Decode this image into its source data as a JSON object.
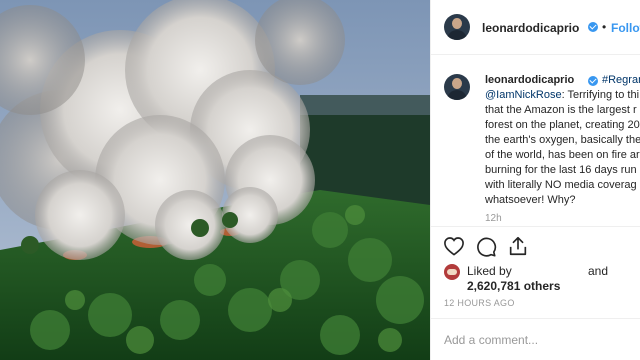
{
  "post": {
    "username": "leonardodicaprio",
    "follow_label": "Follow",
    "separator": "•",
    "caption": {
      "username": "leonardodicaprio",
      "line1": "#Regram #",
      "line2_mention": "@IamNickRose",
      "line2_rest": ": Terrifying to thi",
      "line3": "that the Amazon is the largest r",
      "line4": "forest on the planet, creating 20",
      "line5": "the earth's oxygen, basically the",
      "line6": "of the world, has been on fire ar",
      "line7": "burning for the last 16 days run",
      "line8": "with literally NO media coverag",
      "line9": "whatsoever! Why?"
    },
    "caption_time": "12h",
    "likes": {
      "liked_by_label": "Liked by",
      "and_label": "and",
      "count": "2,620,781 others"
    },
    "time_ago": "12 HOURS AGO",
    "comment_placeholder": "Add a comment..."
  },
  "colors": {
    "link": "#3897f0",
    "hashtag": "#003569",
    "text": "#262626",
    "muted": "#999999",
    "forest": "#1f5a23",
    "smoke": "#d8d6d3"
  },
  "icons": [
    "verified-badge-icon",
    "heart-icon",
    "comment-icon",
    "share-icon"
  ]
}
